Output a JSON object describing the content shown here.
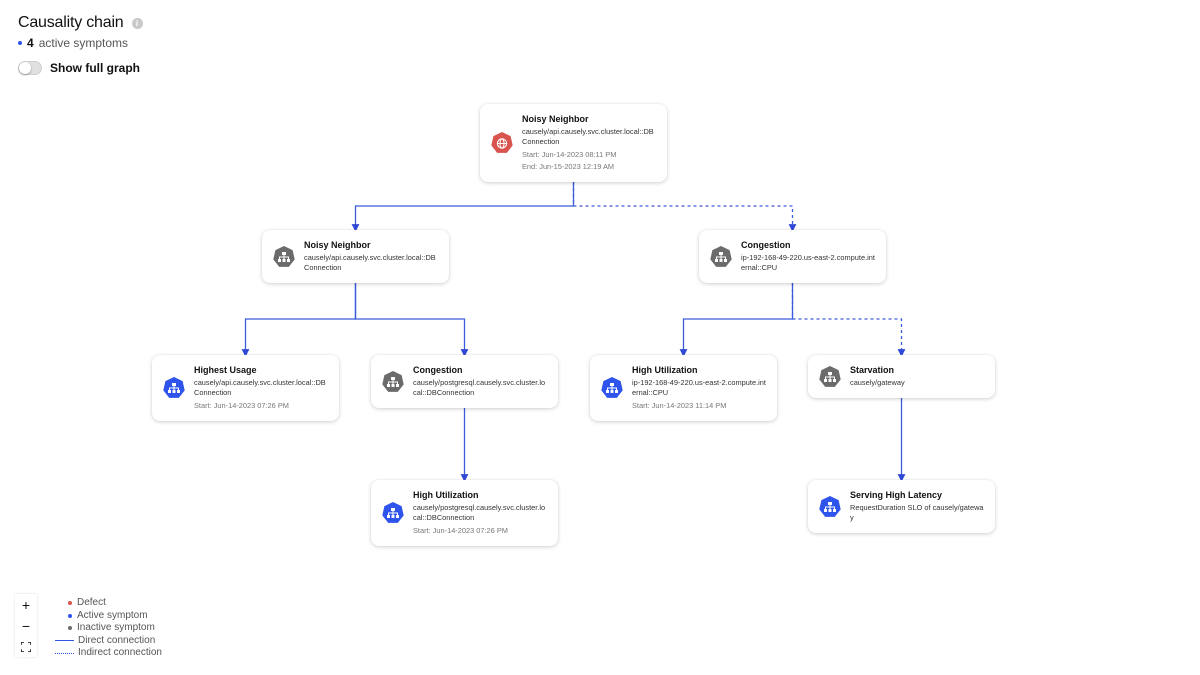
{
  "header": {
    "title": "Causality chain",
    "info_icon": "info-icon",
    "active_count": "4",
    "active_label": "active symptoms",
    "toggle_label": "Show full graph",
    "toggle_on": false
  },
  "colors": {
    "defect": "#d9534f",
    "active": "#2f54eb",
    "inactive": "#6b6b6b",
    "edge": "#3b5bdb"
  },
  "nodes": [
    {
      "id": "n1",
      "name": "Noisy Neighbor",
      "entity": "causely/api.causely.svc.cluster.local::DBConnection",
      "start": "Start: Jun-14-2023 08:11 PM",
      "end": "End: Jun-15-2023 12:19 AM",
      "status": "defect",
      "icon": "globe-icon"
    },
    {
      "id": "n2",
      "name": "Noisy Neighbor",
      "entity": "causely/api.causely.svc.cluster.local::DBConnection",
      "start": "",
      "end": "",
      "status": "inactive",
      "icon": "hierarchy-icon"
    },
    {
      "id": "n3",
      "name": "Congestion",
      "entity": "ip-192-168-49-220.us-east-2.compute.internal::CPU",
      "start": "",
      "end": "",
      "status": "inactive",
      "icon": "hierarchy-icon"
    },
    {
      "id": "n4",
      "name": "Highest Usage",
      "entity": "causely/api.causely.svc.cluster.local::DBConnection",
      "start": "Start: Jun-14-2023 07:26 PM",
      "end": "",
      "status": "active",
      "icon": "hierarchy-icon"
    },
    {
      "id": "n5",
      "name": "Congestion",
      "entity": "causely/postgresql.causely.svc.cluster.local::DBConnection",
      "start": "",
      "end": "",
      "status": "inactive",
      "icon": "hierarchy-icon"
    },
    {
      "id": "n6",
      "name": "High Utilization",
      "entity": "ip-192-168-49-220.us-east-2.compute.internal::CPU",
      "start": "Start: Jun-14-2023 11:14 PM",
      "end": "",
      "status": "active",
      "icon": "hierarchy-icon"
    },
    {
      "id": "n7",
      "name": "Starvation",
      "entity": "causely/gateway",
      "start": "",
      "end": "",
      "status": "inactive",
      "icon": "hierarchy-icon"
    },
    {
      "id": "n8",
      "name": "High Utilization",
      "entity": "causely/postgresql.causely.svc.cluster.local::DBConnection",
      "start": "Start: Jun-14-2023 07:26 PM",
      "end": "",
      "status": "active",
      "icon": "hierarchy-icon"
    },
    {
      "id": "n9",
      "name": "Serving High Latency",
      "entity": "RequestDuration SLO of causely/gateway",
      "start": "",
      "end": "",
      "status": "active",
      "icon": "hierarchy-icon"
    }
  ],
  "edges": [
    {
      "from": "n1",
      "to": "n2",
      "type": "direct"
    },
    {
      "from": "n1",
      "to": "n3",
      "type": "indirect"
    },
    {
      "from": "n2",
      "to": "n4",
      "type": "direct"
    },
    {
      "from": "n2",
      "to": "n5",
      "type": "direct"
    },
    {
      "from": "n3",
      "to": "n6",
      "type": "direct"
    },
    {
      "from": "n3",
      "to": "n7",
      "type": "indirect"
    },
    {
      "from": "n5",
      "to": "n8",
      "type": "direct"
    },
    {
      "from": "n7",
      "to": "n9",
      "type": "direct"
    }
  ],
  "controls": {
    "zoom_in": "+",
    "zoom_out": "−",
    "fit": "⛶"
  },
  "legend": {
    "defect": "Defect",
    "active": "Active symptom",
    "inactive": "Inactive symptom",
    "direct": "Direct connection",
    "indirect": "Indirect connection"
  }
}
